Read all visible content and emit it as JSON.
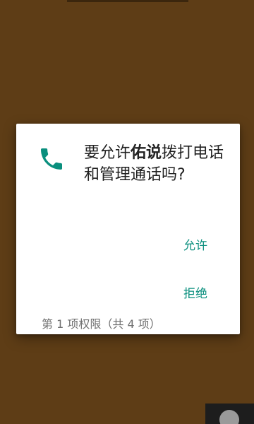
{
  "dialog": {
    "icon": "phone-icon",
    "prompt_prefix": "要允许",
    "app_name": "佑说",
    "prompt_suffix": "拨打电话和管理通话吗?",
    "allow_label": "允许",
    "deny_label": "拒绝",
    "counter": "第 1 项权限（共 4 项）"
  },
  "colors": {
    "background": "#5e3d16",
    "accent": "#0a8f7e"
  },
  "corner_button": {
    "icon": "download-icon"
  }
}
